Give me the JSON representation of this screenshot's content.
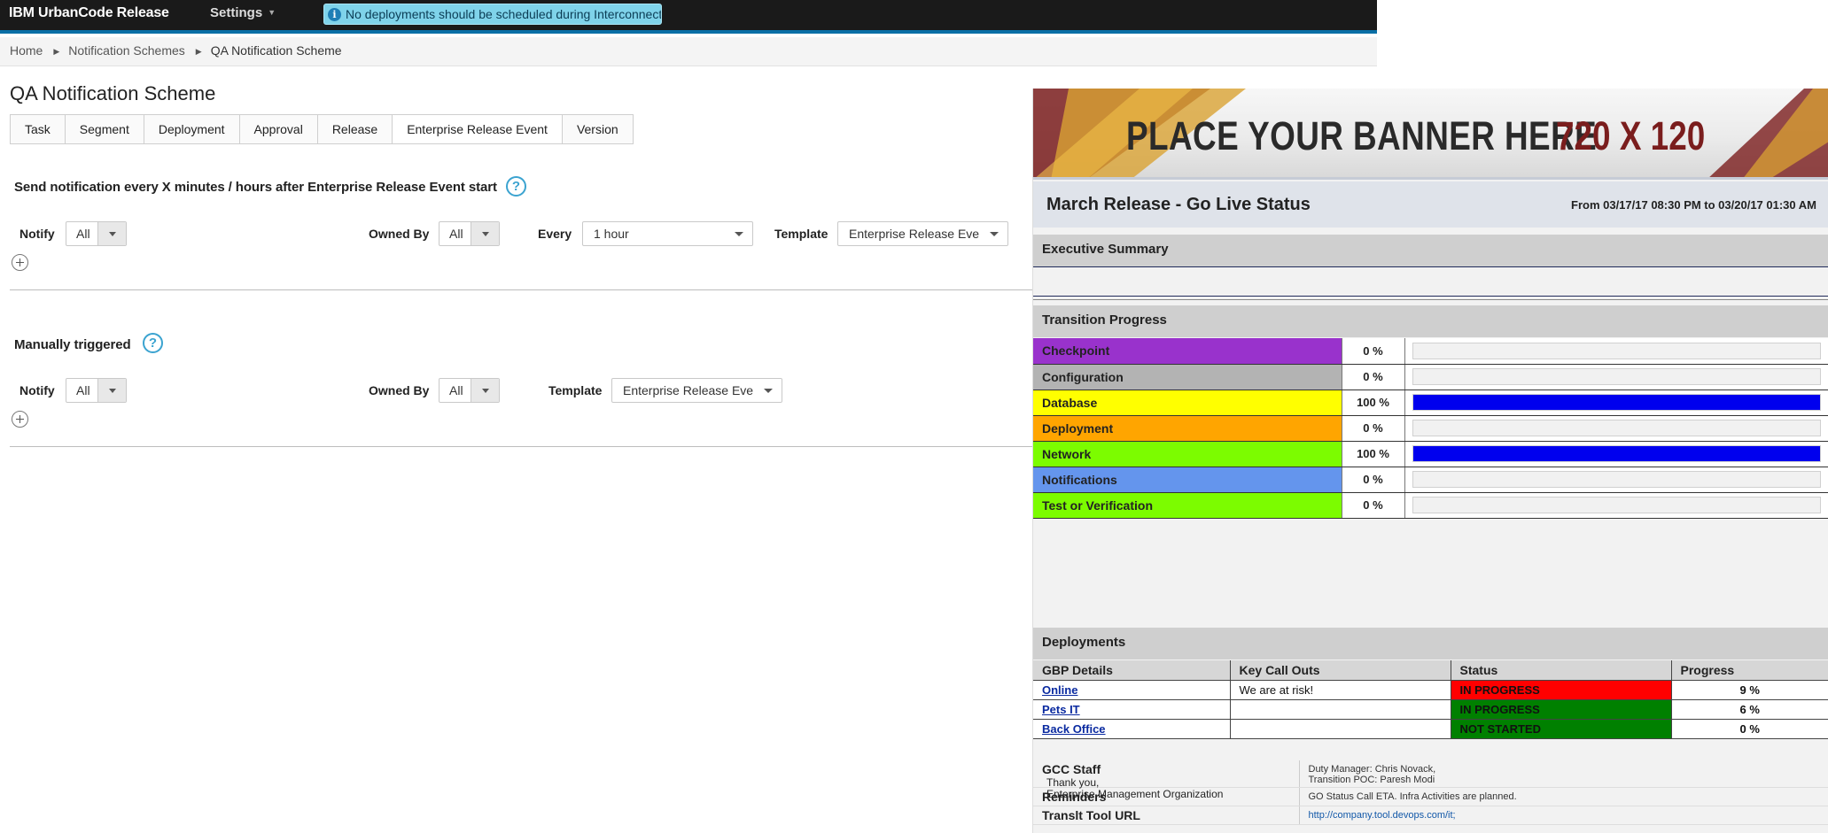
{
  "app": {
    "brand": "IBM UrbanCode Release",
    "settings_label": "Settings",
    "alert_text": "No deployments should be scheduled during Interconnect..."
  },
  "breadcrumb": [
    "Home",
    "Notification Schemes",
    "QA Notification Scheme"
  ],
  "page": {
    "title": "QA Notification Scheme",
    "tabs": [
      {
        "label": "Task"
      },
      {
        "label": "Segment"
      },
      {
        "label": "Deployment"
      },
      {
        "label": "Approval"
      },
      {
        "label": "Release"
      },
      {
        "label": "Enterprise Release Event",
        "active": true
      },
      {
        "label": "Version"
      }
    ]
  },
  "section1": {
    "title": "Send notification every X minutes / hours after Enterprise Release Event start",
    "notify_label": "Notify",
    "notify_value": "All",
    "owned_label": "Owned By",
    "owned_value": "All",
    "every_label": "Every",
    "every_value": "1 hour",
    "template_label": "Template",
    "template_value": "Enterprise Release Eve"
  },
  "section2": {
    "title": "Manually triggered",
    "notify_label": "Notify",
    "notify_value": "All",
    "owned_label": "Owned By",
    "owned_value": "All",
    "template_label": "Template",
    "template_value": "Enterprise Release Eve"
  },
  "email": {
    "banner_text": "PLACE YOUR BANNER HERE",
    "banner_size": "720 X 120",
    "report_title": "March Release - Go Live Status",
    "date_range": "From 03/17/17 08:30 PM to 03/20/17 01:30 AM",
    "executive_summary": "Executive Summary",
    "transition_progress": "Transition Progress",
    "transitions": [
      {
        "name": "Checkpoint",
        "pct_label": "0 %",
        "fraction": 0,
        "color": "#9932cc"
      },
      {
        "name": "Configuration",
        "pct_label": "0 %",
        "fraction": 0,
        "color": "#b3b3b3"
      },
      {
        "name": "Database",
        "pct_label": "100 %",
        "fraction": 1,
        "color": "#ffff00"
      },
      {
        "name": "Deployment",
        "pct_label": "0 %",
        "fraction": 0,
        "color": "#ffa500"
      },
      {
        "name": "Network",
        "pct_label": "100 %",
        "fraction": 1,
        "color": "#7cfc00"
      },
      {
        "name": "Notifications",
        "pct_label": "0 %",
        "fraction": 0,
        "color": "#6495ed"
      },
      {
        "name": "Test or Verification",
        "pct_label": "0 %",
        "fraction": 0,
        "color": "#7cfc00"
      }
    ],
    "deployments_title": "Deployments",
    "deployment_headers": [
      "GBP Details",
      "Key Call Outs",
      "Status",
      "Progress"
    ],
    "deployments": [
      {
        "name": "Online",
        "callout": "We are at risk!",
        "status": "IN PROGRESS",
        "status_color": "#ff0000",
        "progress": "9 %"
      },
      {
        "name": "Pets IT",
        "callout": "",
        "status": "IN PROGRESS",
        "status_color": "#008000",
        "progress": "6 %"
      },
      {
        "name": "Back Office",
        "callout": "",
        "status": "NOT STARTED",
        "status_color": "#008000",
        "progress": "0 %"
      }
    ],
    "info": [
      {
        "key": "GCC Staff",
        "lines": [
          "Duty Manager: Chris Novack,",
          "Transition POC: Paresh Modi"
        ]
      },
      {
        "key": "Reminders",
        "lines": [
          "GO Status Call ETA. Infra Activities are planned."
        ]
      },
      {
        "key": "Translt Tool URL",
        "lines": [
          "http://company.tool.devops.com/it;"
        ],
        "link": true
      }
    ],
    "signoff": [
      "Thank you,",
      "Enterprise Management Organization"
    ]
  }
}
